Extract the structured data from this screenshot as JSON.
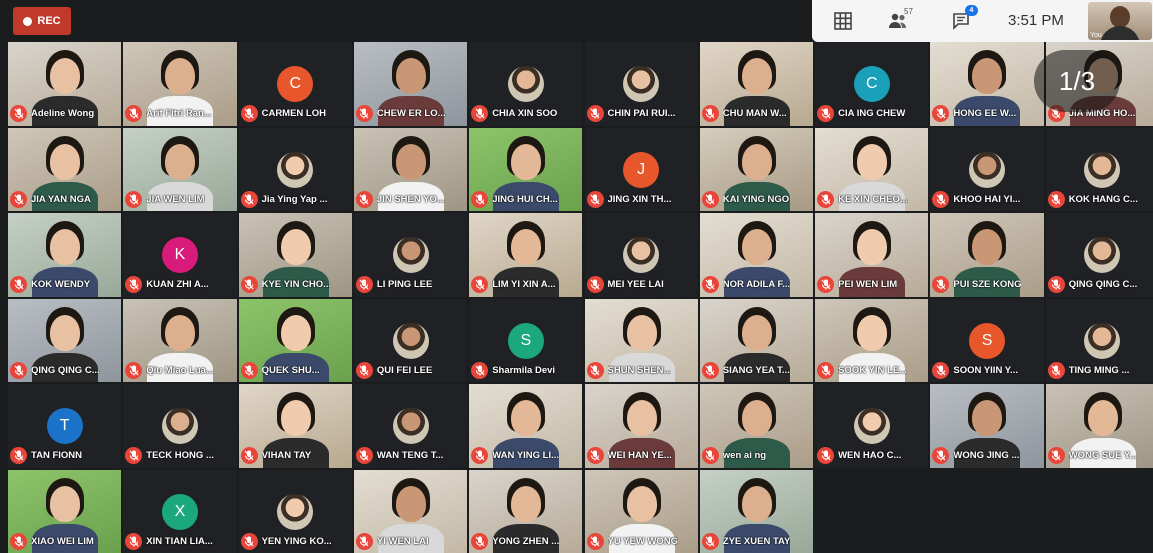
{
  "rec": {
    "label": "REC"
  },
  "topbar": {
    "grid_icon": "grid-view-icon",
    "participants_icon": "people-icon",
    "participants_count": "57",
    "chat_icon": "chat-icon",
    "chat_badge": "4",
    "time": "3:51 PM",
    "self_label": "You"
  },
  "pagination": {
    "label": "1/3"
  },
  "colors": {
    "mic_muted": "#e8463a",
    "rec": "#c0392b",
    "badge": "#1a73e8"
  },
  "participants": [
    {
      "name": "Adeline Wong",
      "avatar": "video"
    },
    {
      "name": "Arif Fitri Ran...",
      "avatar": "video"
    },
    {
      "name": "CARMEN LOH",
      "avatar": "letter",
      "letter": "C",
      "color": "#e8572b"
    },
    {
      "name": "CHEW ER LO...",
      "avatar": "video"
    },
    {
      "name": "CHIA XIN SOO",
      "avatar": "photo"
    },
    {
      "name": "CHIN PAI RUI...",
      "avatar": "photo"
    },
    {
      "name": "CHU MAN W...",
      "avatar": "video"
    },
    {
      "name": "CIA ING CHEW",
      "avatar": "letter",
      "letter": "C",
      "color": "#1aa0b8"
    },
    {
      "name": "HONG EE W...",
      "avatar": "video"
    },
    {
      "name": "JIA MING HO...",
      "avatar": "video"
    },
    {
      "name": "JIA YAN NGA",
      "avatar": "video"
    },
    {
      "name": "JIA WEN LIM",
      "avatar": "video"
    },
    {
      "name": "Jia Ying Yap ...",
      "avatar": "photo"
    },
    {
      "name": "JIN SHEN YO...",
      "avatar": "video"
    },
    {
      "name": "JING HUI CH...",
      "avatar": "video"
    },
    {
      "name": "JING XIN TH...",
      "avatar": "letter",
      "letter": "J",
      "color": "#e8572b"
    },
    {
      "name": "KAI YING NGO",
      "avatar": "video"
    },
    {
      "name": "KE XIN CHEO...",
      "avatar": "video"
    },
    {
      "name": "KHOO HAI YI...",
      "avatar": "photo"
    },
    {
      "name": "KOK HANG C...",
      "avatar": "photo"
    },
    {
      "name": "KOK WENDY",
      "avatar": "video"
    },
    {
      "name": "KUAN ZHI A...",
      "avatar": "letter",
      "letter": "K",
      "color": "#d81b7a"
    },
    {
      "name": "KYE YIN CHO...",
      "avatar": "video"
    },
    {
      "name": "LI PING LEE",
      "avatar": "photo"
    },
    {
      "name": "LIM YI XIN A...",
      "avatar": "video"
    },
    {
      "name": "MEI YEE LAI",
      "avatar": "photo"
    },
    {
      "name": "NOR ADILA F...",
      "avatar": "video"
    },
    {
      "name": "PEI WEN LIM",
      "avatar": "video"
    },
    {
      "name": "PUI SZE KONG",
      "avatar": "video"
    },
    {
      "name": "QING QING C...",
      "avatar": "photo"
    },
    {
      "name": "QING QING C...",
      "avatar": "video"
    },
    {
      "name": "Qiu Miao Lua...",
      "avatar": "video"
    },
    {
      "name": "QUEK SHU...",
      "avatar": "video"
    },
    {
      "name": "QUI FEI LEE",
      "avatar": "photo"
    },
    {
      "name": "Sharmila Devi",
      "avatar": "letter",
      "letter": "S",
      "color": "#1aa87c"
    },
    {
      "name": "SHUN SHEN...",
      "avatar": "video"
    },
    {
      "name": "SIANG YEA T...",
      "avatar": "video"
    },
    {
      "name": "SOOK YIN LE...",
      "avatar": "video"
    },
    {
      "name": "SOON YIIN Y...",
      "avatar": "letter",
      "letter": "S",
      "color": "#e8572b"
    },
    {
      "name": "TING MING ...",
      "avatar": "photo"
    },
    {
      "name": "TAN FIONN",
      "avatar": "letter",
      "letter": "T",
      "color": "#1a73c8"
    },
    {
      "name": "TECK HONG ...",
      "avatar": "photo"
    },
    {
      "name": "VIHAN TAY",
      "avatar": "video"
    },
    {
      "name": "WAN TENG T...",
      "avatar": "photo"
    },
    {
      "name": "WAN YING LI...",
      "avatar": "video"
    },
    {
      "name": "WEI HAN YE...",
      "avatar": "video"
    },
    {
      "name": "wen ai ng",
      "avatar": "video"
    },
    {
      "name": "WEN HAO C...",
      "avatar": "photo"
    },
    {
      "name": "WONG JING ...",
      "avatar": "video"
    },
    {
      "name": "WONG SUE Y...",
      "avatar": "video"
    },
    {
      "name": "XIAO WEI LIM",
      "avatar": "video"
    },
    {
      "name": "XIN TIAN LIA...",
      "avatar": "letter",
      "letter": "X",
      "color": "#1aa87c"
    },
    {
      "name": "YEN YING KO...",
      "avatar": "photo"
    },
    {
      "name": "YI WEN LAI",
      "avatar": "video"
    },
    {
      "name": "YONG ZHEN ...",
      "avatar": "video"
    },
    {
      "name": "YU YEW WONG",
      "avatar": "video"
    },
    {
      "name": "ZYE XUEN TAY",
      "avatar": "video"
    }
  ]
}
